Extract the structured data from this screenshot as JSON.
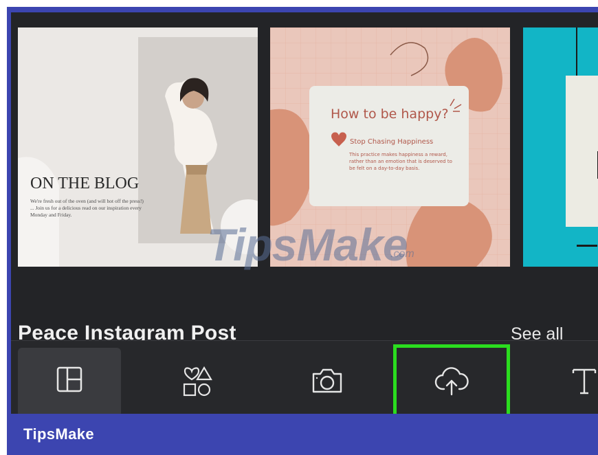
{
  "templates": [
    {
      "heading": "ON THE BLOG",
      "body": "We're fresh out of the oven (and will hot off the press!) ... Join us for a delicious read on our inspiration every Monday and Friday."
    },
    {
      "heading": "How to be happy?",
      "subheading": "Stop Chasing Happiness",
      "body": "This practice makes happiness a reward, rather than an emotion that is deserved to be felt on a day-to-day basis."
    },
    {}
  ],
  "section": {
    "title": "Peace Instagram Post",
    "see_all": "See all"
  },
  "tabs": [
    {
      "icon": "templates-icon"
    },
    {
      "icon": "elements-icon"
    },
    {
      "icon": "camera-icon"
    },
    {
      "icon": "upload-cloud-icon"
    },
    {
      "icon": "text-icon"
    }
  ],
  "watermark": {
    "main": "TipsMake",
    "sub": ".com"
  },
  "brand": "TipsMake",
  "colors": {
    "frame": "#3c45b0",
    "highlight": "#2bdd1f",
    "background": "#232427"
  }
}
